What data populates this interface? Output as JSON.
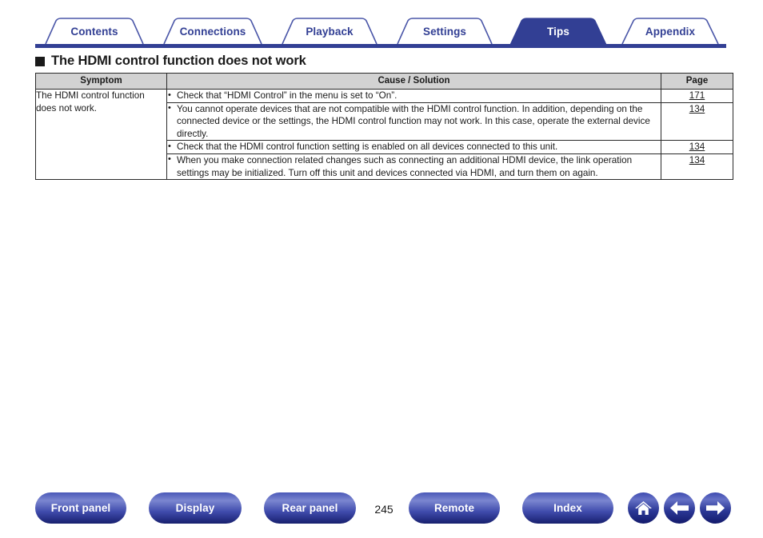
{
  "tabs": [
    {
      "label": "Contents",
      "active": false
    },
    {
      "label": "Connections",
      "active": false
    },
    {
      "label": "Playback",
      "active": false
    },
    {
      "label": "Settings",
      "active": false
    },
    {
      "label": "Tips",
      "active": true
    },
    {
      "label": "Appendix",
      "active": false
    }
  ],
  "heading": {
    "text": "The HDMI control function does not work"
  },
  "table": {
    "headers": {
      "symptom": "Symptom",
      "cause": "Cause / Solution",
      "page": "Page"
    },
    "symptom": "The HDMI control function does not work.",
    "rows": [
      {
        "cause": "Check that “HDMI Control” in the menu is set to “On”.",
        "page": "171"
      },
      {
        "cause": "You cannot operate devices that are not compatible with the HDMI control function. In addition, depending on the connected device or the settings, the HDMI control function may not work. In this case, operate the external device directly.",
        "page": "134"
      },
      {
        "cause": "Check that the HDMI control function setting is enabled on all devices connected to this unit.",
        "page": "134"
      },
      {
        "cause": "When you make connection related changes such as connecting an additional HDMI device, the link operation settings may be initialized. Turn off this unit and devices connected via HDMI, and turn them on again.",
        "page": "134"
      }
    ]
  },
  "footer": {
    "buttons": [
      {
        "label": "Front panel"
      },
      {
        "label": "Display"
      },
      {
        "label": "Rear panel"
      },
      {
        "label": "Remote"
      },
      {
        "label": "Index"
      }
    ],
    "page_number": "245",
    "nav_icons": [
      "home-icon",
      "back-arrow-icon",
      "forward-arrow-icon"
    ]
  },
  "colors": {
    "brand_blue": "#323f94",
    "header_gray": "#d2d2d2",
    "text": "#1a1a1a"
  }
}
